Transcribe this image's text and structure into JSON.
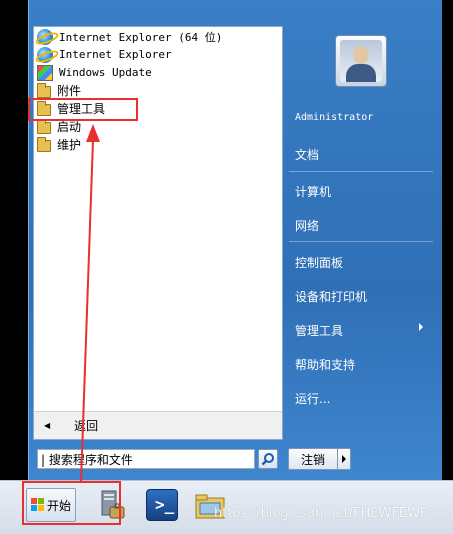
{
  "programs": [
    {
      "label": "Internet Explorer (64 位)",
      "icon": "ie-icon",
      "font": "mono"
    },
    {
      "label": "Internet Explorer",
      "icon": "ie-icon",
      "font": "mono"
    },
    {
      "label": "Windows Update",
      "icon": "windows-update-icon",
      "font": "mono"
    },
    {
      "label": "附件",
      "icon": "folder-icon",
      "font": "cn"
    },
    {
      "label": "管理工具",
      "icon": "folder-icon",
      "font": "cn"
    },
    {
      "label": "启动",
      "icon": "folder-icon",
      "font": "cn"
    },
    {
      "label": "维护",
      "icon": "folder-icon",
      "font": "cn"
    }
  ],
  "back_label": "返回",
  "search": {
    "value": "| 搜索程序和文件"
  },
  "user": {
    "name": "Administrator"
  },
  "right_items": {
    "documents": "文档",
    "computer": "计算机",
    "network": "网络",
    "control_panel": "控制面板",
    "devices_printers": "设备和打印机",
    "admin_tools": "管理工具",
    "help": "帮助和支持",
    "run": "运行..."
  },
  "logoff_label": "注销",
  "start_label": "开始",
  "powershell_glyph": ">_",
  "watermark": "https://blog.csdn.net/FHEWFEWF",
  "annotation_color": "#e8302e"
}
